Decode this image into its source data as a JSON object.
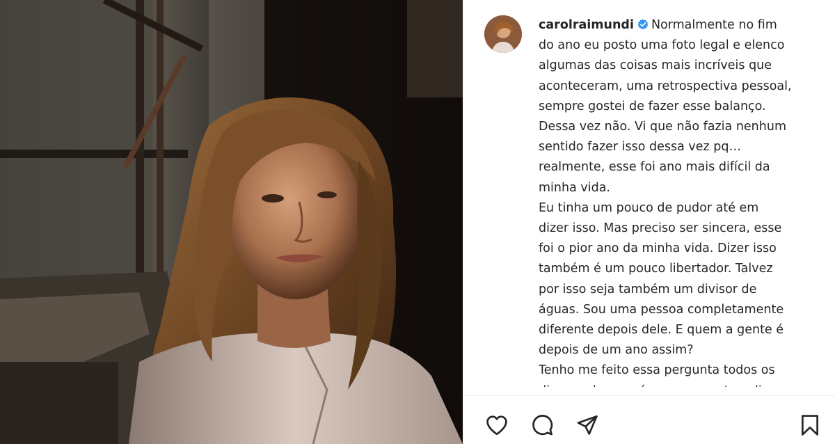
{
  "post": {
    "username": "carolraimundi",
    "verified": true,
    "caption_lines": [
      "Normalmente no fim",
      "do ano eu posto uma foto legal e elenco",
      "algumas das coisas mais incríveis que",
      "aconteceram, uma retrospectiva pessoal,",
      "sempre gostei de fazer esse balanço.",
      "Dessa vez não. Vi que não fazia nenhum",
      "sentido fazer isso dessa vez pq…",
      "realmente, esse foi ano mais difícil da",
      "minha vida.",
      "Eu tinha um pouco de pudor até em",
      "dizer isso. Mas preciso ser sincera, esse",
      "foi o pior ano da minha vida. Dizer isso",
      "também é um pouco libertador. Talvez",
      "por isso seja também um divisor de",
      "águas. Sou uma pessoa completamente",
      "diferente depois dele. E quem a gente é",
      "depois de um ano assim?",
      "Tenho me feito essa pergunta todos os",
      "dias e acho que é uma pergunta valiosa"
    ]
  },
  "actions": {
    "like_icon": "heart-icon",
    "comment_icon": "comment-icon",
    "share_icon": "paper-plane-icon",
    "save_icon": "bookmark-icon"
  },
  "colors": {
    "text": "#262626",
    "verified_badge": "#3897f0",
    "divider": "#efefef"
  }
}
